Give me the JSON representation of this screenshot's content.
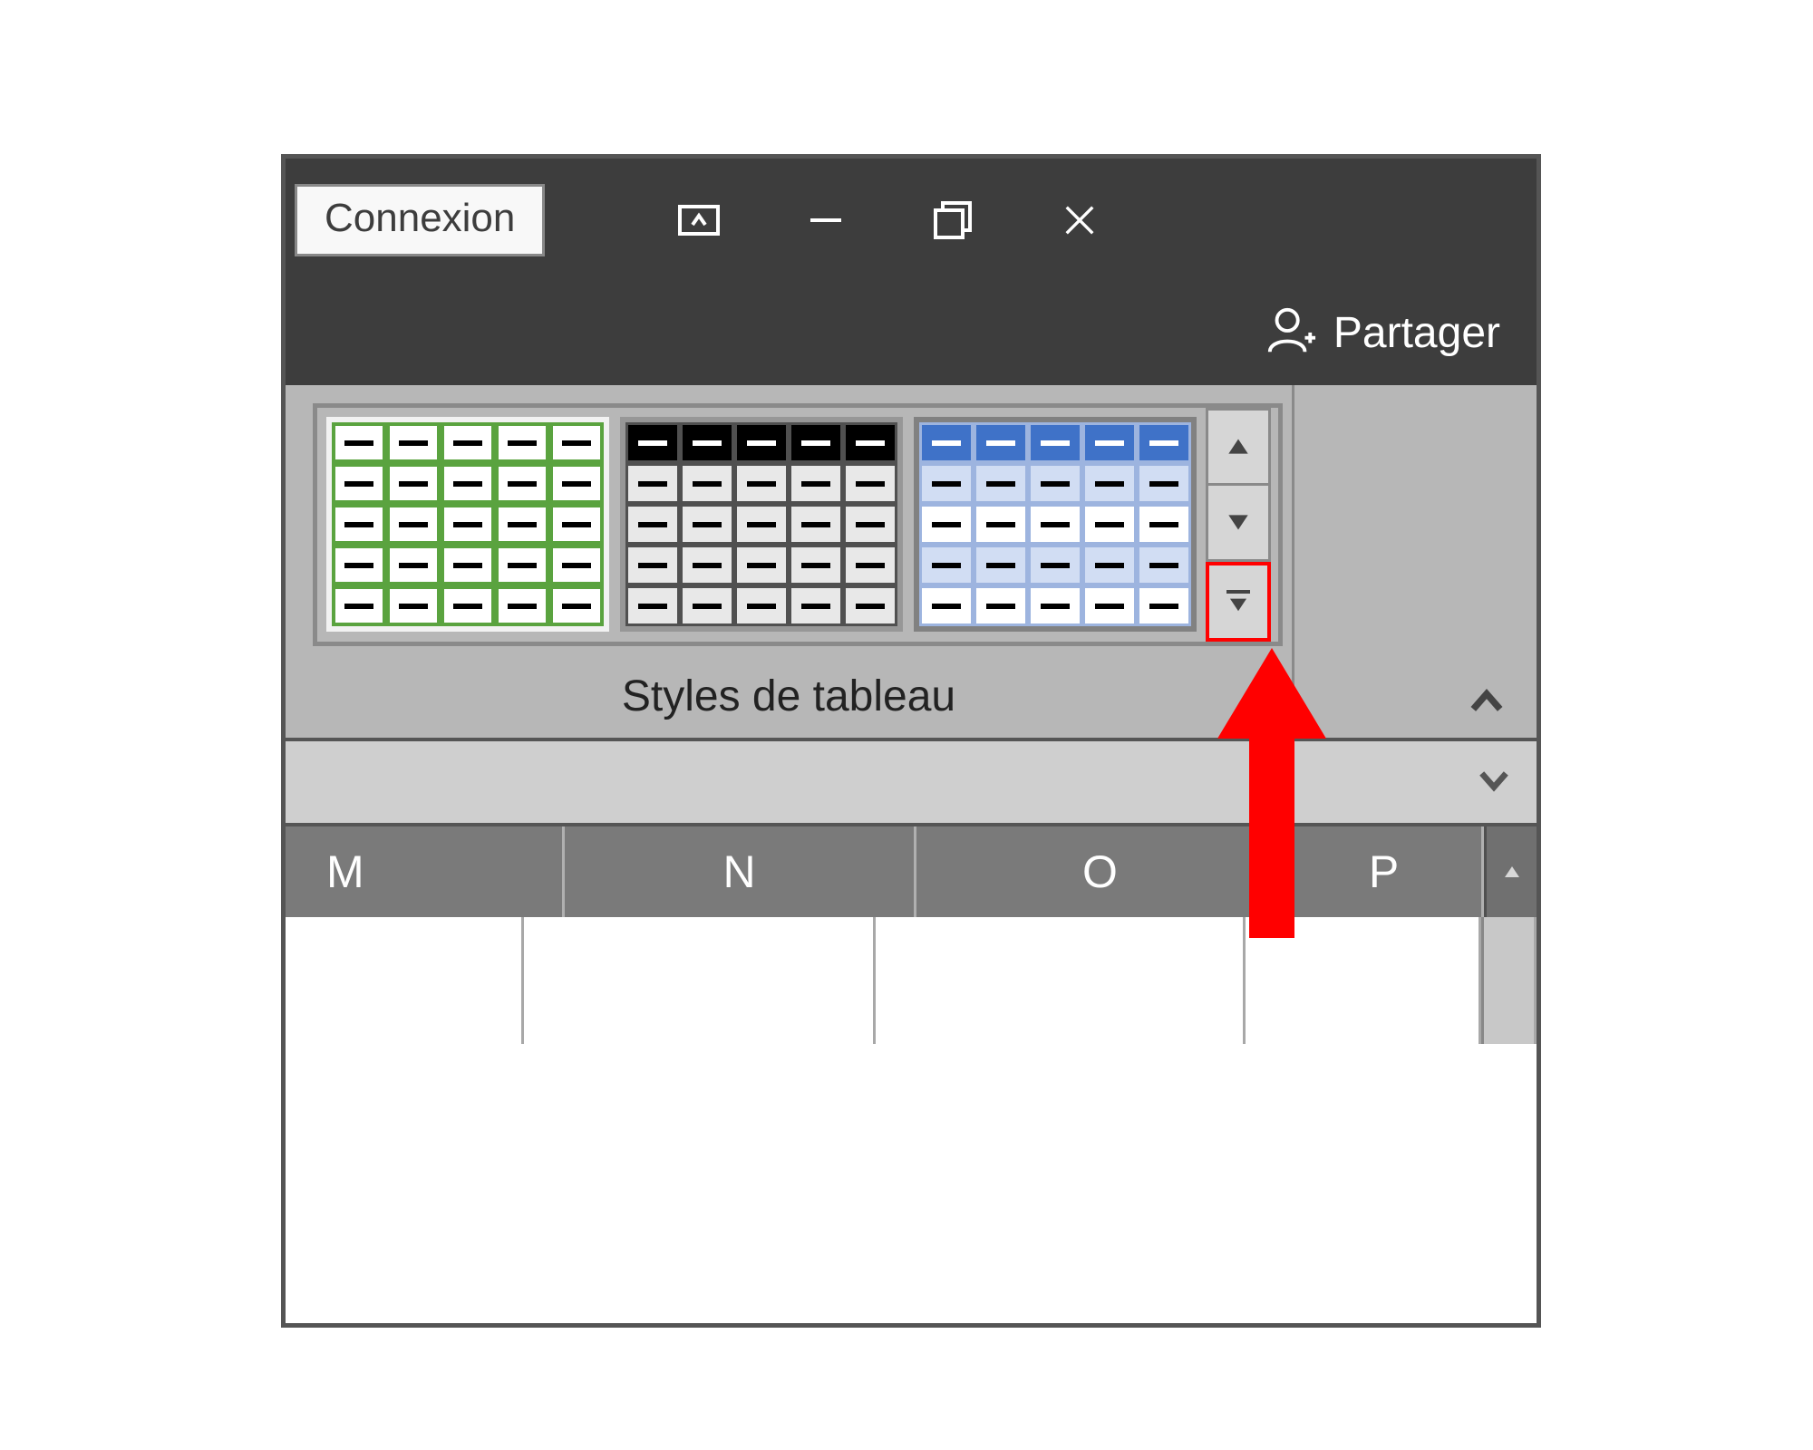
{
  "titlebar": {
    "connexion_label": "Connexion"
  },
  "share": {
    "label": "Partager"
  },
  "ribbon": {
    "group_label": "Styles de tableau",
    "styles": [
      {
        "name": "table-style-green"
      },
      {
        "name": "table-style-black-header"
      },
      {
        "name": "table-style-blue-banded"
      }
    ]
  },
  "columns": {
    "m": "M",
    "n": "N",
    "o": "O",
    "p": "P"
  }
}
